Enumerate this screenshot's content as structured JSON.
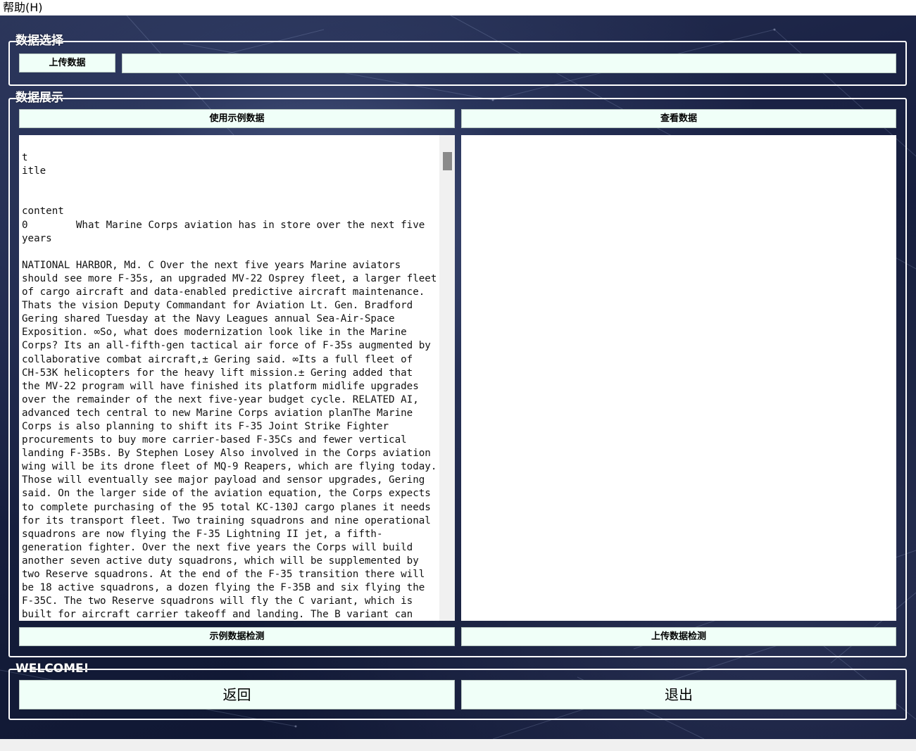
{
  "menubar": {
    "help_label": "帮助(H)"
  },
  "data_select": {
    "title": "数据选择",
    "upload_label": "上传数据",
    "path_value": ""
  },
  "data_display": {
    "title": "数据展示",
    "use_sample_label": "使用示例数据",
    "view_data_label": "查看数据",
    "sample_detect_label": "示例数据检测",
    "upload_detect_label": "上传数据检测",
    "text_content": "                                                                      t\nitle\n\n\ncontent\n0        What Marine Corps aviation has in store over the next five\nyears\n\nNATIONAL HARBOR, Md. C Over the next five years Marine aviators\nshould see more F-35s, an upgraded MV-22 Osprey fleet, a larger fleet\nof cargo aircraft and data-enabled predictive aircraft maintenance.\nThats the vision Deputy Commandant for Aviation Lt. Gen. Bradford\nGering shared Tuesday at the Navy Leagues annual Sea-Air-Space\nExposition. ∞So, what does modernization look like in the Marine\nCorps? Its an all-fifth-gen tactical air force of F-35s augmented by\ncollaborative combat aircraft,± Gering said. ∞Its a full fleet of\nCH-53K helicopters for the heavy lift mission.± Gering added that\nthe MV-22 program will have finished its platform midlife upgrades\nover the remainder of the next five-year budget cycle. RELATED AI,\nadvanced tech central to new Marine Corps aviation planThe Marine\nCorps is also planning to shift its F-35 Joint Strike Fighter\nprocurements to buy more carrier-based F-35Cs and fewer vertical\nlanding F-35Bs. By Stephen Losey Also involved in the Corps aviation\nwing will be its drone fleet of MQ-9 Reapers, which are flying today.\nThose will eventually see major payload and sensor upgrades, Gering\nsaid. On the larger side of the aviation equation, the Corps expects\nto complete purchasing of the 95 total KC-130J cargo planes it needs\nfor its transport fleet. Two training squadrons and nine operational\nsquadrons are now flying the F-35 Lightning II jet, a fifth-\ngeneration fighter. Over the next five years the Corps will build\nanother seven active duty squadrons, which will be supplemented by\ntwo Reserve squadrons. At the end of the F-35 transition there will\nbe 18 active squadrons, a dozen flying the F-35B and six flying the\nF-35C. The two Reserve squadrons will fly the C variant, which is\nbuilt for aircraft carrier takeoff and landing. The B variant can\nconduct vertical takeoff and landing. Gering said the Corps also"
  },
  "welcome": {
    "title": "WELCOME!",
    "back_label": "返回",
    "exit_label": "退出"
  },
  "colors": {
    "button_bg": "#f0fff8",
    "frame": "#ffffff",
    "background": "#1a2244"
  }
}
